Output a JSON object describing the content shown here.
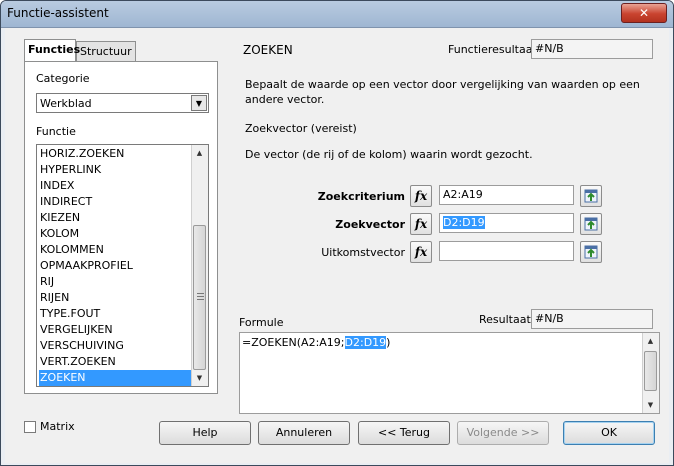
{
  "window": {
    "title": "Functie-assistent",
    "close_label": "✕"
  },
  "tabs": [
    {
      "label": "Functies",
      "active": true
    },
    {
      "label": "Structuur",
      "active": false
    }
  ],
  "left": {
    "category_label": "Categorie",
    "category_value": "Werkblad",
    "function_label": "Functie",
    "functions": [
      "HORIZ.ZOEKEN",
      "HYPERLINK",
      "INDEX",
      "INDIRECT",
      "KIEZEN",
      "KOLOM",
      "KOLOMMEN",
      "OPMAAKPROFIEL",
      "RIJ",
      "RIJEN",
      "TYPE.FOUT",
      "VERGELIJKEN",
      "VERSCHUIVING",
      "VERT.ZOEKEN",
      "ZOEKEN"
    ],
    "selected_function": "ZOEKEN"
  },
  "right": {
    "function_name": "ZOEKEN",
    "function_result_label": "Functieresultaat",
    "function_result_value": "#N/B",
    "description": "Bepaalt de waarde op een vector door vergelijking van waarden op een andere vector.",
    "param_title": "Zoekvector (vereist)",
    "param_description": "De vector (de rij of de kolom) waarin wordt gezocht.",
    "args": [
      {
        "label": "Zoekcriterium",
        "value": "A2:A19",
        "bold": true
      },
      {
        "label": "Zoekvector",
        "value": "D2:D19",
        "bold": true
      },
      {
        "label": "Uitkomstvector",
        "value": "",
        "bold": false
      }
    ],
    "formula_label": "Formule",
    "result_label": "Resultaat",
    "result_value": "#N/B",
    "formula_prefix": "=ZOEKEN(A2:A19;",
    "formula_highlight": "D2:D19",
    "formula_suffix": ")"
  },
  "bottom": {
    "matrix_label": "Matrix",
    "help": "Help",
    "cancel": "Annuleren",
    "back": "<< Terug",
    "next": "Volgende >>",
    "ok": "OK"
  }
}
